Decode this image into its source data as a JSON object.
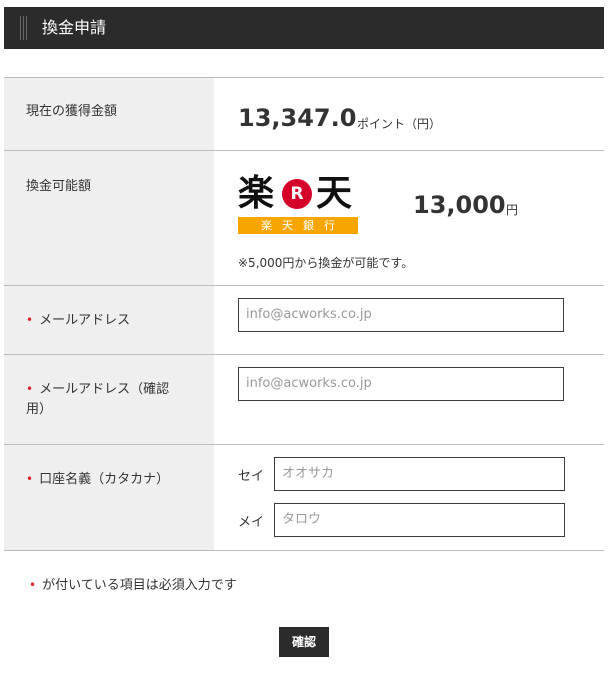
{
  "header": {
    "title": "換金申請"
  },
  "balance": {
    "label": "現在の獲得金額",
    "amount": "13,347.0",
    "unit": "ポイント（円）"
  },
  "exchange": {
    "label": "換金可能額",
    "bank_logo": {
      "chars": [
        "楽",
        "R",
        "天"
      ],
      "sub": "楽天銀行"
    },
    "amount": "13,000",
    "unit": "円",
    "note": "※5,000円から換金が可能です。"
  },
  "email": {
    "label": "メールアドレス",
    "placeholder": "info@acworks.co.jp"
  },
  "email_confirm": {
    "label_line1": "メールアドレス（確認",
    "label_line2": "用）",
    "placeholder": "info@acworks.co.jp"
  },
  "account": {
    "label": "口座名義（カタカナ）",
    "sei_label": "セイ",
    "sei_placeholder": "オオサカ",
    "mei_label": "メイ",
    "mei_placeholder": "タロウ"
  },
  "required_marker": "•",
  "footer_note": "が付いている項目は必須入力です",
  "confirm_button": "確認",
  "colors": {
    "header_bg": "#2b2b2b",
    "label_bg": "#efefef",
    "required": "#d8262f",
    "bank_red": "#d4002a",
    "bank_orange": "#f7a600"
  }
}
